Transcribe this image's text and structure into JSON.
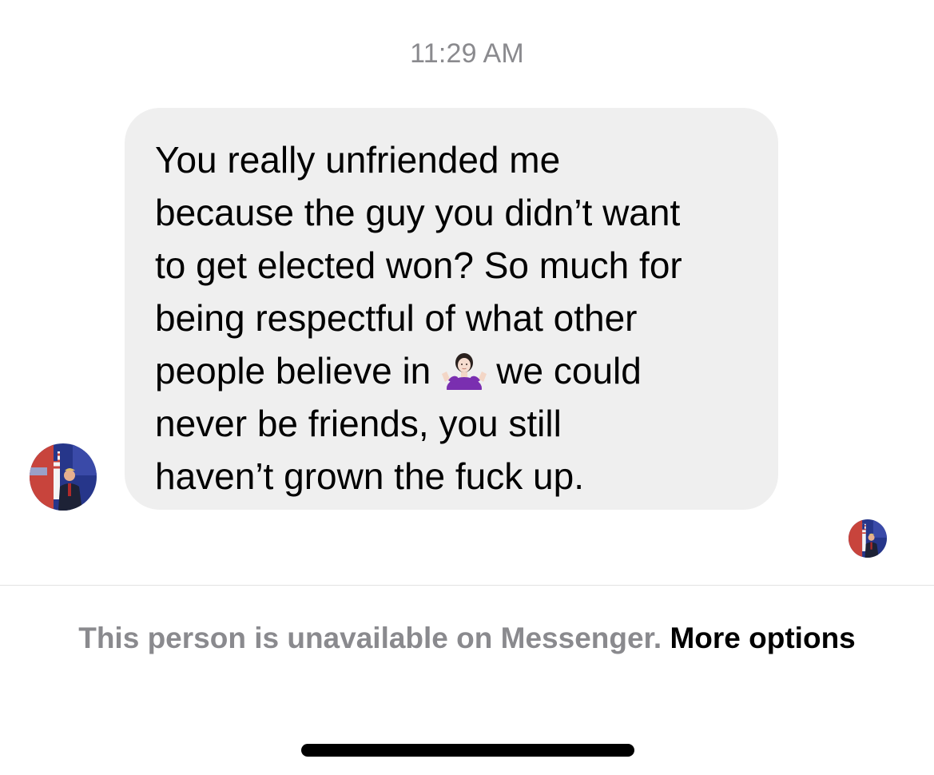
{
  "thread": {
    "timestamp": "11:29 AM"
  },
  "message": {
    "lines": [
      "You really unfriended me",
      "because the guy you didn’t want",
      "to get elected won? So much for",
      "being respectful of what other",
      "people believe in",
      "we could",
      "never be friends, you still",
      "haven’t grown the fuck up."
    ],
    "emoji": "person-shrugging-emoji"
  },
  "footer": {
    "notice_text": "This person is unavailable on Messenger.",
    "link_text": "More options"
  },
  "icons": {
    "sender_avatar": "sender-avatar",
    "seen_avatar": "seen-receipt-avatar"
  },
  "colors": {
    "bubble_bg": "#efefef",
    "muted_text": "#8a8a8e",
    "divider": "#e2e2e2",
    "emoji_shirt": "#7a2fb0"
  }
}
